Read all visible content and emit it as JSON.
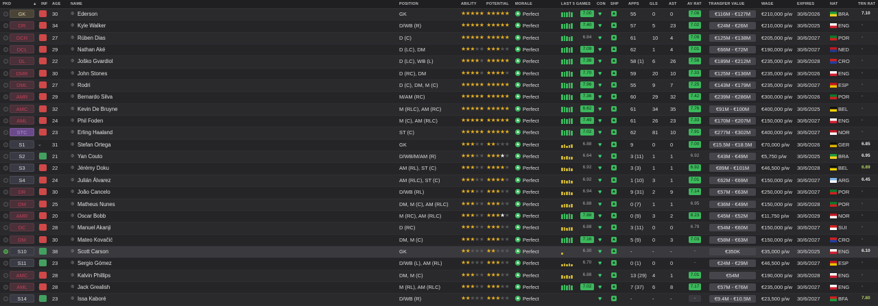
{
  "headers": {
    "pkd": "PKD",
    "inf": "INF",
    "age": "AGE",
    "name": "NAME",
    "position": "POSITION",
    "ability": "ABILITY",
    "potential": "POTENTIAL",
    "morale": "MORALE",
    "last5": "LAST 5 GAMES",
    "con": "CON",
    "shp": "SHP",
    "apps": "APPS",
    "gls": "GLS",
    "ast": "AST",
    "avrat": "AV RAT",
    "tv": "TRANSFER VALUE",
    "wage": "WAGE",
    "expires": "EXPIRES",
    "nat": "NAT",
    "trnrat": "TRN RAT"
  },
  "colors": {
    "accent_green": "#3cb85c",
    "star_gold": "#e8b020",
    "injury_red": "#d04848"
  },
  "players": [
    {
      "pos": "GK",
      "posStyle": "gk",
      "inf": "r",
      "age": "30",
      "name": "Ederson",
      "position": "GK",
      "abil": 4.5,
      "pot": 4.5,
      "morale": "Perfect",
      "last5": [
        7,
        7,
        7,
        8,
        7
      ],
      "lg": "7.00",
      "apps": "55",
      "gls": "0",
      "ast": "0",
      "avr": "7.08",
      "tv": "€116M - €127M",
      "wage": "€210,000 p/w",
      "exp": "30/6/2026",
      "flag": "BRA",
      "nat": "BRA",
      "trn": "7.10"
    },
    {
      "pos": "DR",
      "posStyle": "red",
      "inf": "r",
      "age": "34",
      "name": "Kyle Walker",
      "position": "D/WB (R)",
      "abil": 4.5,
      "pot": 4.5,
      "morale": "Perfect",
      "last5": [
        7,
        7,
        8,
        7,
        8
      ],
      "lg": "7.40",
      "apps": "57",
      "gls": "5",
      "ast": "23",
      "avr": "7.02",
      "tv": "€24M - €26M",
      "wage": "€210,000 p/w",
      "exp": "30/6/2025",
      "flag": "ENG",
      "nat": "ENG",
      "trn": "-"
    },
    {
      "pos": "DCR",
      "posStyle": "red",
      "inf": "r",
      "age": "27",
      "name": "Rúben Dias",
      "position": "D (C)",
      "abil": 4.5,
      "pot": 4.5,
      "morale": "Perfect",
      "last5": [
        7,
        8,
        7,
        6,
        7
      ],
      "lg": "6.84",
      "lgPlain": true,
      "apps": "61",
      "gls": "10",
      "ast": "4",
      "avr": "7.09",
      "tv": "€125M - €138M",
      "wage": "€205,000 p/w",
      "exp": "30/6/2027",
      "flag": "POR",
      "nat": "POR",
      "trn": "-"
    },
    {
      "pos": "DCL",
      "posStyle": "red",
      "inf": "r",
      "age": "29",
      "name": "Nathan Aké",
      "position": "D (LC), DM",
      "abil": 3,
      "pot": 3,
      "morale": "Perfect",
      "last5": [
        7,
        7,
        8,
        7,
        8
      ],
      "lg": "7.09",
      "apps": "62",
      "gls": "1",
      "ast": "4",
      "avr": "7.01",
      "tv": "€66M - €72M",
      "wage": "€190,000 p/w",
      "exp": "30/6/2027",
      "flag": "NED",
      "nat": "NED",
      "trn": "-"
    },
    {
      "pos": "DL",
      "posStyle": "red",
      "inf": "r",
      "age": "22",
      "name": "Joško Gvardiol",
      "position": "D (LC), WB (L)",
      "abil": 4,
      "pot": 4.5,
      "morale": "Perfect",
      "last5": [
        7,
        8,
        7,
        8,
        8
      ],
      "lg": "7.38",
      "apps": "58 (1)",
      "gls": "6",
      "ast": "26",
      "avr": "7.58",
      "tv": "€189M - €212M",
      "wage": "€235,000 p/w",
      "exp": "30/6/2028",
      "flag": "CRO",
      "nat": "CRO",
      "trn": "-"
    },
    {
      "pos": "DMR",
      "posStyle": "red",
      "inf": "r",
      "age": "30",
      "name": "John Stones",
      "position": "D (RC), DM",
      "abil": 4,
      "pot": 4,
      "morale": "Perfect",
      "last5": [
        7,
        7,
        8,
        8,
        7
      ],
      "lg": "7.70",
      "apps": "59",
      "gls": "20",
      "ast": "10",
      "avr": "7.33",
      "tv": "€125M - €136M",
      "wage": "€235,000 p/w",
      "exp": "30/6/2026",
      "flag": "ENG",
      "nat": "ENG",
      "trn": "-"
    },
    {
      "pos": "DML",
      "posStyle": "red",
      "inf": "r",
      "age": "27",
      "name": "Rodri",
      "position": "D (C), DM, M (C)",
      "abil": 5,
      "pot": 5,
      "morale": "Perfect",
      "last5": [
        8,
        8,
        7,
        8,
        8
      ],
      "lg": "7.96",
      "apps": "55",
      "gls": "9",
      "ast": "7",
      "avr": "7.25",
      "tv": "€143M - €179M",
      "wage": "€235,000 p/w",
      "exp": "30/6/2027",
      "flag": "ESP",
      "nat": "ESP",
      "trn": "-"
    },
    {
      "pos": "AMR",
      "posStyle": "red",
      "inf": "r",
      "age": "29",
      "name": "Bernardo Silva",
      "position": "M/AM (RC)",
      "abil": 5,
      "pot": 5,
      "morale": "Perfect",
      "last5": [
        8,
        7,
        8,
        8,
        7
      ],
      "lg": "7.36",
      "apps": "60",
      "gls": "29",
      "ast": "32",
      "avr": "7.42",
      "tv": "€239M - €286M",
      "wage": "€300,000 p/w",
      "exp": "30/6/2026",
      "flag": "POR",
      "nat": "POR",
      "trn": "-"
    },
    {
      "pos": "AMC",
      "posStyle": "red",
      "inf": "r",
      "age": "32",
      "name": "Kevin De Bruyne",
      "position": "M (RLC), AM (RC)",
      "abil": 5,
      "pot": 5,
      "morale": "Perfect",
      "last5": [
        8,
        8,
        7,
        7,
        8
      ],
      "lg": "6.62",
      "apps": "61",
      "gls": "34",
      "ast": "35",
      "avr": "7.76",
      "tv": "€91M - €100M",
      "wage": "€400,000 p/w",
      "exp": "30/6/2025",
      "flag": "BEL",
      "nat": "BEL",
      "trn": "-"
    },
    {
      "pos": "AML",
      "posStyle": "red",
      "inf": "r",
      "age": "24",
      "name": "Phil Foden",
      "position": "M (C), AM (RLC)",
      "abil": 5,
      "pot": 5,
      "morale": "Perfect",
      "last5": [
        7,
        8,
        7,
        8,
        8
      ],
      "lg": "7.49",
      "apps": "61",
      "gls": "26",
      "ast": "23",
      "avr": "7.33",
      "tv": "€170M - €207M",
      "wage": "€150,000 p/w",
      "exp": "30/6/2027",
      "flag": "ENG",
      "nat": "ENG",
      "trn": "-"
    },
    {
      "pos": "STC",
      "posStyle": "purple",
      "inf": "r",
      "age": "23",
      "name": "Erling Haaland",
      "position": "ST (C)",
      "abil": 5,
      "pot": 5,
      "morale": "Perfect",
      "last5": [
        8,
        7,
        8,
        8,
        7
      ],
      "lg": "7.02",
      "apps": "62",
      "gls": "81",
      "ast": "10",
      "avr": "7.91",
      "tv": "€277M - €302M",
      "wage": "€400,000 p/w",
      "exp": "30/6/2027",
      "flag": "NOR",
      "nat": "NOR",
      "trn": "-"
    },
    {
      "pos": "S1",
      "posStyle": "",
      "inf": "",
      "age": "31",
      "name": "Stefan Ortega",
      "position": "GK",
      "abil": 3,
      "pot": 2,
      "potExtra": "",
      "morale": "Perfect",
      "last5": [
        4,
        5,
        3,
        4,
        5
      ],
      "lastY": true,
      "lg": "6.88",
      "lgPlain": true,
      "apps": "9",
      "gls": "0",
      "ast": "0",
      "avr": "7.00",
      "tv": "€15.5M - €18.5M",
      "wage": "€70,000 p/w",
      "exp": "30/6/2026",
      "flag": "GER",
      "nat": "GER",
      "trn": "6.85"
    },
    {
      "pos": "S2",
      "posStyle": "",
      "inf": "g",
      "age": "21",
      "name": "Yan Couto",
      "position": "D/WB/M/AM (R)",
      "abil": 3,
      "pot": 3.5,
      "potW": true,
      "morale": "Perfect",
      "last5": [
        5,
        4,
        5,
        4,
        4
      ],
      "lastY": true,
      "lg": "6.64",
      "lgPlain": true,
      "apps": "3 (11)",
      "gls": "1",
      "ast": "1",
      "avr": "6.92",
      "avrPlain": true,
      "tv": "€43M - €49M",
      "wage": "€5,750 p/w",
      "exp": "30/6/2025",
      "flag": "BRA",
      "nat": "BRA",
      "trn": "6.95"
    },
    {
      "pos": "S3",
      "posStyle": "",
      "inf": "r",
      "age": "22",
      "name": "Jérémy Doku",
      "position": "AM (RL), ST (C)",
      "abil": 3,
      "pot": 3.5,
      "morale": "Perfect",
      "last5": [
        5,
        5,
        4,
        5,
        4
      ],
      "lastY": true,
      "lg": "6.92",
      "lgPlain": true,
      "apps": "3 (3)",
      "gls": "1",
      "ast": "1",
      "avr": "6.92",
      "tv": "€89M - €101M",
      "wage": "€46,500 p/w",
      "exp": "30/6/2028",
      "flag": "BEL",
      "nat": "BEL",
      "trn": "6.89",
      "trnG": true
    },
    {
      "pos": "S4",
      "posStyle": "",
      "inf": "r",
      "age": "24",
      "name": "Julián Álvarez",
      "position": "AM (RLC), ST (C)",
      "abil": 3,
      "pot": 3.5,
      "morale": "Perfect",
      "last5": [
        5,
        5,
        4,
        5,
        4
      ],
      "lastY": true,
      "lg": "6.92",
      "lgPlain": true,
      "apps": "1 (10)",
      "gls": "3",
      "ast": "1",
      "avr": "7.01",
      "tv": "€62M - €69M",
      "wage": "€150,000 p/w",
      "exp": "30/6/2027",
      "flag": "ARG",
      "nat": "ARG",
      "trn": "6.45"
    },
    {
      "pos": "DR",
      "posStyle": "red",
      "inf": "r",
      "age": "30",
      "name": "João Cancelo",
      "position": "D/WB (RL)",
      "abil": 3,
      "pot": 3,
      "morale": "Perfect",
      "last5": [
        5,
        4,
        5,
        5,
        4
      ],
      "lastY": true,
      "lg": "6.94",
      "lgPlain": true,
      "apps": "9 (31)",
      "gls": "2",
      "ast": "9",
      "avr": "7.14",
      "tv": "€57M - €63M",
      "wage": "€250,000 p/w",
      "exp": "30/6/2027",
      "flag": "POR",
      "nat": "POR",
      "trn": "-"
    },
    {
      "pos": "DM",
      "posStyle": "red",
      "inf": "r",
      "age": "25",
      "name": "Matheus Nunes",
      "position": "DM, M (C), AM (RLC)",
      "abil": 3,
      "pot": 3,
      "morale": "Perfect",
      "last5": [
        4,
        5,
        5,
        4,
        5
      ],
      "lastY": true,
      "lg": "6.88",
      "lgPlain": true,
      "apps": "0 (7)",
      "gls": "1",
      "ast": "1",
      "avr": "6.95",
      "avrPlain": true,
      "tv": "€36M - €49M",
      "wage": "€150,000 p/w",
      "exp": "30/6/2028",
      "flag": "POR",
      "nat": "POR",
      "trn": "-"
    },
    {
      "pos": "AMR",
      "posStyle": "red",
      "inf": "r",
      "age": "20",
      "name": "Oscar Bobb",
      "position": "M (RC), AM (RLC)",
      "abil": 2.5,
      "pot": 3.5,
      "potW": true,
      "morale": "Perfect",
      "last5": [
        7,
        8,
        7,
        8,
        7
      ],
      "lg": "7.88",
      "apps": "0 (9)",
      "gls": "3",
      "ast": "2",
      "avr": "8.23",
      "tv": "€45M - €52M",
      "wage": "€11,750 p/w",
      "exp": "30/6/2029",
      "flag": "NOR",
      "nat": "NOR",
      "trn": "-"
    },
    {
      "pos": "DC",
      "posStyle": "red",
      "inf": "r",
      "age": "28",
      "name": "Manuel Akanji",
      "position": "D (RC)",
      "abil": 3,
      "pot": 3,
      "morale": "Perfect",
      "last5": [
        5,
        5,
        4,
        5,
        5
      ],
      "lastY": true,
      "lg": "6.88",
      "lgPlain": true,
      "apps": "3 (11)",
      "gls": "0",
      "ast": "0",
      "avr": "6.79",
      "avrPlain": true,
      "tv": "€54M - €60M",
      "wage": "€150,000 p/w",
      "exp": "30/6/2027",
      "flag": "SUI",
      "nat": "SUI",
      "trn": "-"
    },
    {
      "pos": "DM",
      "posStyle": "red",
      "inf": "r",
      "age": "30",
      "name": "Mateo Kovačić",
      "position": "DM, M (C)",
      "abil": 3,
      "pot": 3,
      "morale": "Perfect",
      "last5": [
        7,
        7,
        8,
        7,
        8
      ],
      "lg": "7.16",
      "apps": "5 (9)",
      "gls": "0",
      "ast": "3",
      "avr": "7.03",
      "tv": "€58M - €63M",
      "wage": "€150,000 p/w",
      "exp": "30/6/2027",
      "flag": "CRO",
      "nat": "CRO",
      "trn": "-"
    },
    {
      "pos": "S10",
      "posStyle": "",
      "inf": "g",
      "age": "38",
      "name": "Scott Carson",
      "position": "GK",
      "abil": 1.5,
      "pot": 1.5,
      "morale": "Perfect",
      "last5": [
        3
      ],
      "lastY": true,
      "lg": "6.30",
      "lgPlain": true,
      "apps": "-",
      "gls": "-",
      "ast": "-",
      "avr": "-",
      "avrDash": true,
      "tv": "€350K",
      "wage": "€35,000 p/w",
      "exp": "30/6/2025",
      "flag": "ENG",
      "nat": "ENG",
      "trn": "6.10",
      "sel": true
    },
    {
      "pos": "S11",
      "posStyle": "",
      "inf": "g",
      "age": "23",
      "name": "Sergio Gómez",
      "position": "D/WB (L), AM (RL)",
      "abil": 2,
      "pot": 2.5,
      "morale": "Perfect",
      "last5": [
        3,
        4,
        3,
        4,
        3
      ],
      "lastY": true,
      "lg": "6.70",
      "lgPlain": true,
      "apps": "0 (1)",
      "gls": "0",
      "ast": "0",
      "avr": "-",
      "avrPlain": true,
      "tv": "€24M - €29M",
      "wage": "€46,500 p/w",
      "exp": "30/6/2027",
      "flag": "ESP",
      "nat": "ESP",
      "trn": "-"
    },
    {
      "pos": "AMC",
      "posStyle": "red",
      "inf": "r",
      "age": "28",
      "name": "Kalvin Phillips",
      "position": "DM, M (C)",
      "abil": 2.5,
      "pot": 2.5,
      "morale": "Perfect",
      "last5": [
        5,
        4,
        5,
        4,
        5
      ],
      "lastY": true,
      "lg": "6.88",
      "lgPlain": true,
      "apps": "13 (29)",
      "gls": "4",
      "ast": "1",
      "avr": "7.01",
      "tv": "€54M",
      "wage": "€190,000 p/w",
      "exp": "30/6/2028",
      "flag": "ENG",
      "nat": "ENG",
      "trn": "-"
    },
    {
      "pos": "AML",
      "posStyle": "red",
      "inf": "r",
      "age": "28",
      "name": "Jack Grealish",
      "position": "M (RL), AM (RLC)",
      "abil": 3,
      "pot": 3,
      "morale": "Perfect",
      "last5": [
        7,
        8,
        7,
        8,
        7
      ],
      "lg": "7.02",
      "apps": "7 (37)",
      "gls": "6",
      "ast": "8",
      "avr": "7.17",
      "tv": "€57M - €76M",
      "wage": "€235,000 p/w",
      "exp": "30/6/2027",
      "flag": "ENG",
      "nat": "ENG",
      "trn": "-"
    },
    {
      "pos": "S14",
      "posStyle": "",
      "inf": "g",
      "age": "23",
      "name": "Issa Kaboré",
      "position": "D/WB (R)",
      "abil": 2,
      "pot": 2.5,
      "morale": "Perfect",
      "last5": [],
      "lg": "",
      "lgPlain": true,
      "apps": "-",
      "gls": "-",
      "ast": "-",
      "avr": "-",
      "avrDash": true,
      "tv": "€9.4M - €10.5M",
      "wage": "€23,500 p/w",
      "exp": "30/6/2027",
      "flag": "BFA",
      "nat": "BFA",
      "trn": "7.80",
      "trnG": true
    }
  ],
  "flags": {
    "BRA": [
      "#1e9a3c",
      "#f5d020"
    ],
    "ENG": [
      "#ffffff",
      "#d02030"
    ],
    "POR": [
      "#0a7a2a",
      "#d02020"
    ],
    "NED": [
      "#c01820",
      "#203a8a"
    ],
    "CRO": [
      "#d02020",
      "#2040a0"
    ],
    "ESP": [
      "#c01820",
      "#f0c000"
    ],
    "BEL": [
      "#111111",
      "#f0d000"
    ],
    "NOR": [
      "#c01820",
      "#ffffff"
    ],
    "GER": [
      "#111111",
      "#e0b000"
    ],
    "ARG": [
      "#80b8e8",
      "#ffffff"
    ],
    "SUI": [
      "#d02020",
      "#ffffff"
    ],
    "BFA": [
      "#d02020",
      "#1a9a3a"
    ]
  }
}
